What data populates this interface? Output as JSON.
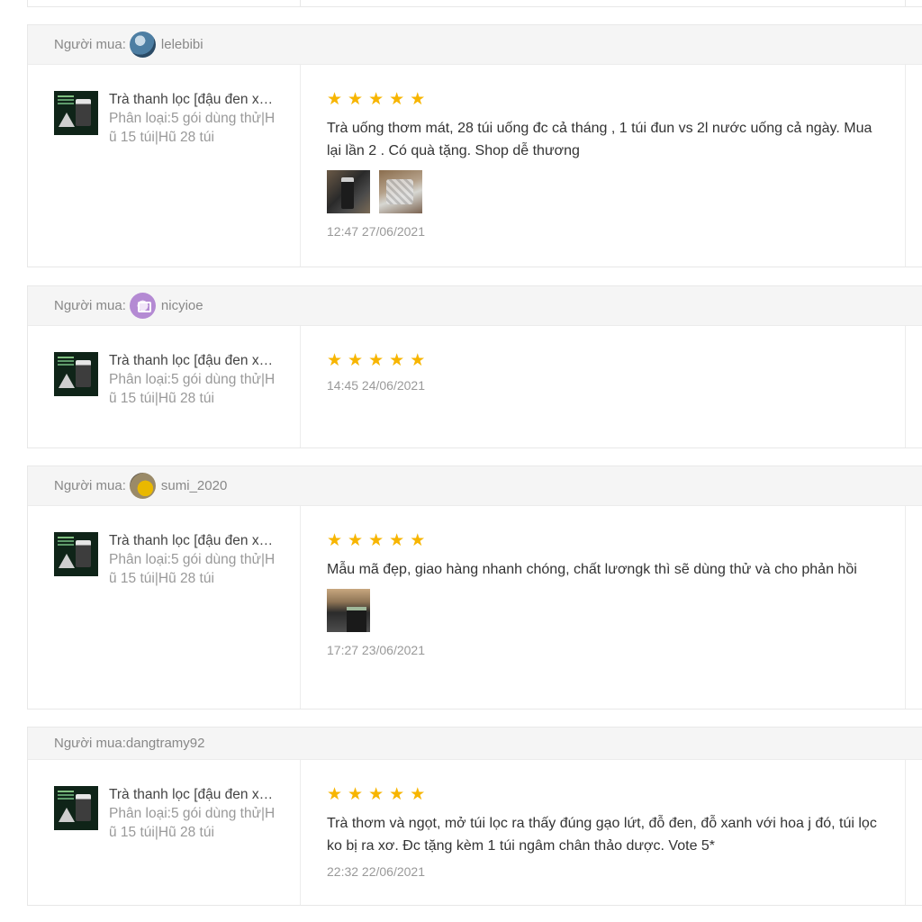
{
  "buyer_prefix": "Người mua:",
  "product": {
    "name": "Trà thanh lọc [đậu đen xanh gạo lứt]",
    "variant": "Phân loại:5 gói dùng thử|Hũ 15 túi|Hũ 28 túi"
  },
  "star_glyph": "★",
  "reviews": [
    {
      "buyer": "lelebibi",
      "avatar": "avatar-blue",
      "rating": 5,
      "comment": "Trà uống thơm mát, 28 túi uống đc cả tháng , 1 túi đun vs 2l nước uống cả ngày. Mua lại lần 2 . Có quà tặng. Shop dễ thương",
      "images": [
        "photo-jar",
        "photo-bag"
      ],
      "time": "12:47 27/06/2021"
    },
    {
      "buyer": "nicyioe",
      "avatar": "avatar-purple",
      "rating": 5,
      "comment": "",
      "images": [],
      "time": "14:45 24/06/2021"
    },
    {
      "buyer": "sumi_2020",
      "avatar": "avatar-yellow",
      "rating": 5,
      "comment": "Mẫu mã đẹp, giao hàng nhanh chóng, chất lươngk thì sẽ dùng thử và cho phản hồi",
      "images": [
        "photo-box"
      ],
      "time": "17:27 23/06/2021"
    },
    {
      "buyer": "dangtramy92",
      "avatar": "",
      "rating": 5,
      "comment": "Trà thơm và ngọt, mở túi lọc ra thấy đúng gạo lứt, đỗ đen, đỗ xanh với hoa j đó, túi lọc ko bị ra xơ. Đc tặng kèm 1 túi ngâm chân thảo dược. Vote 5*",
      "images": [],
      "time": "22:32 22/06/2021"
    }
  ],
  "colors": {
    "star": "#f7b500",
    "header_bg": "#f5f5f5",
    "border": "#e8e8e8",
    "muted_text": "#999999"
  }
}
